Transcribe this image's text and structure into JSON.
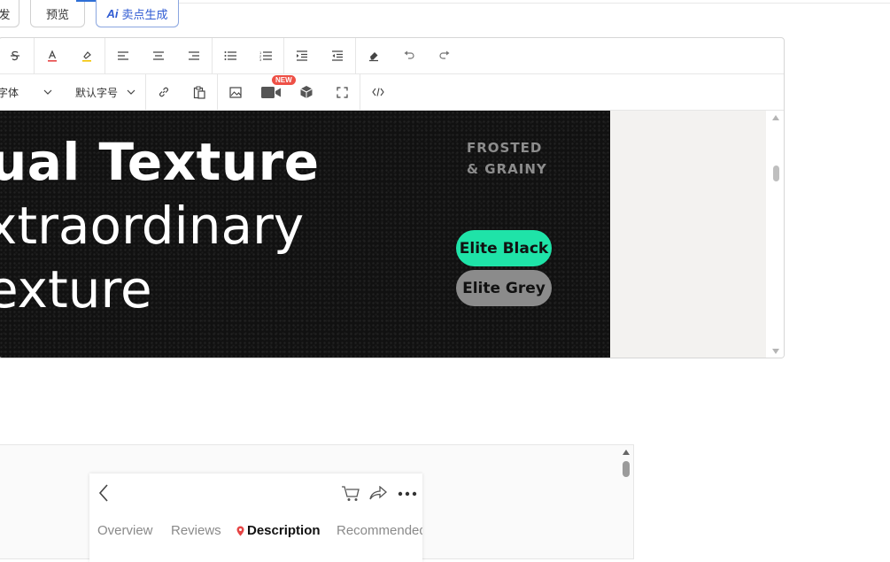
{
  "top_buttons": {
    "left_partial": "发",
    "preview": "预览",
    "ai_prefix": "Ai",
    "ai_label": "卖点生成"
  },
  "toolbar": {
    "font_family_placeholder": "字体",
    "font_size_placeholder": "默认字号",
    "video_badge": "NEW"
  },
  "banner": {
    "line1": "ual Texture",
    "line2": "xtraordinary",
    "line3": "exture",
    "side_line1": "FROSTED",
    "side_line2": "& GRAINY",
    "option1": "Elite Black",
    "option2": "Elite Grey",
    "option1_color": "#1fe3a8",
    "option2_color": "#8b8b8b"
  },
  "preview": {
    "tabs": [
      "Overview",
      "Reviews",
      "Description",
      "Recommended"
    ],
    "active_tab": "Description"
  },
  "colors": {
    "accent": "#2f6fd6",
    "badge": "#ee5046"
  }
}
